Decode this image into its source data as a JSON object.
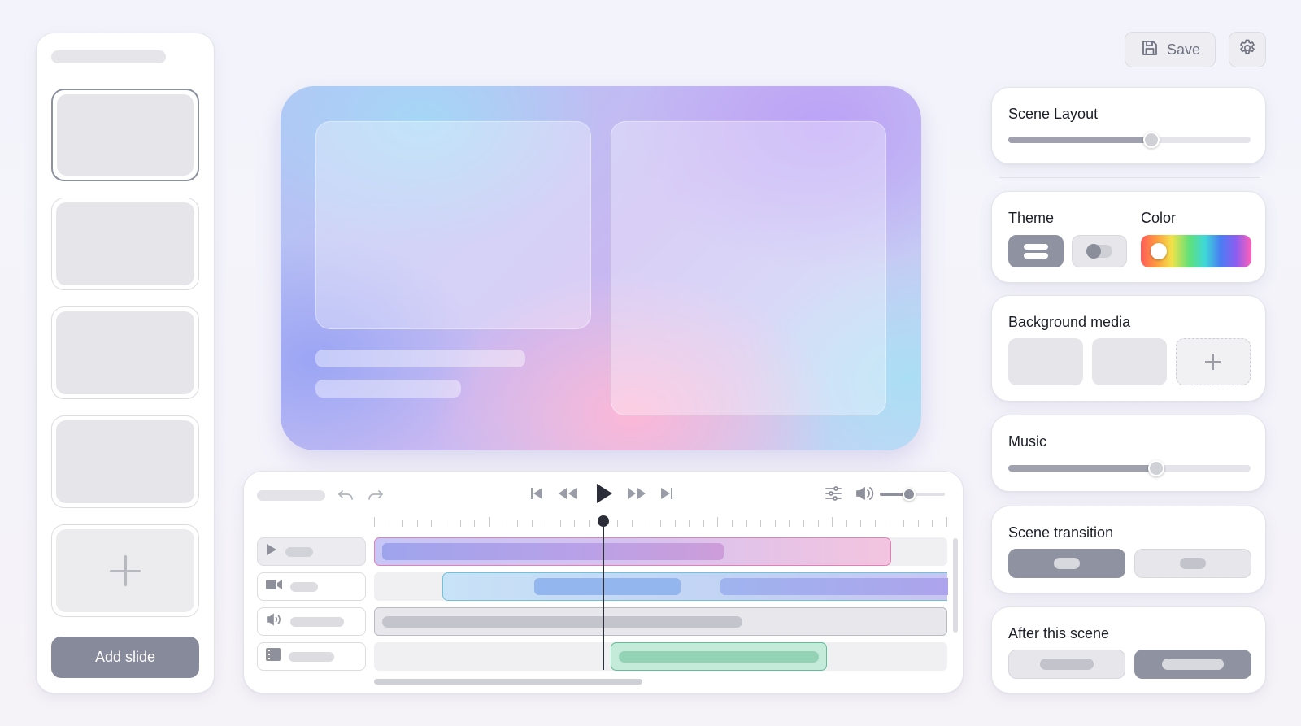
{
  "toolbar": {
    "save_label": "Save",
    "save_icon": "floppy-disk-icon",
    "settings_icon": "gear-icon"
  },
  "slides": {
    "count": 4,
    "selected_index": 0,
    "add_slide_label": "Add slide"
  },
  "properties": {
    "scene_layout": {
      "title": "Scene Layout",
      "value_fraction": 0.59
    },
    "theme": {
      "title": "Theme"
    },
    "color": {
      "title": "Color"
    },
    "background_media": {
      "title": "Background media"
    },
    "music": {
      "title": "Music",
      "value_fraction": 0.61
    },
    "scene_transition": {
      "title": "Scene transition",
      "selected_index": 0
    },
    "after_this_scene": {
      "title": "After this scene",
      "selected_index": 1
    }
  },
  "timeline": {
    "volume_fraction": 0.45,
    "playhead_fraction": 0.4,
    "tracks": [
      {
        "icon": "play-icon"
      },
      {
        "icon": "video-camera-icon"
      },
      {
        "icon": "speaker-icon"
      },
      {
        "icon": "film-strip-icon"
      }
    ]
  },
  "colors": {
    "accent_gray": "#8f92a0",
    "clip_purple": "#a79cf0",
    "clip_pink": "#f2b6d6",
    "clip_blue": "#a9c9f3",
    "clip_teal": "#8fd1b4"
  }
}
